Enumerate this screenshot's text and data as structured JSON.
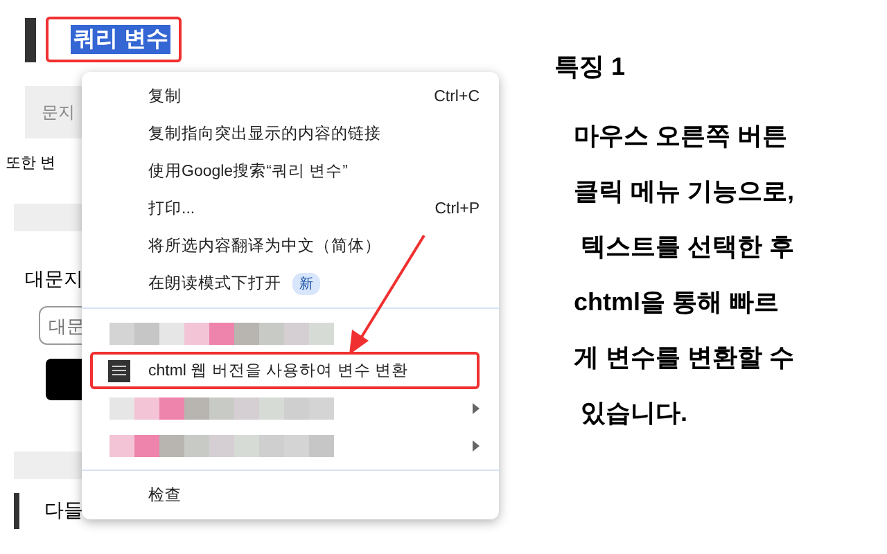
{
  "page": {
    "heading": "쿼리 변수",
    "heading_selected": true,
    "field_1": "문지",
    "text_1": "또한 변",
    "label_1": "대문지",
    "input_1": {
      "placeholder": "대문"
    },
    "heading_2": "다들"
  },
  "context_menu": {
    "items": [
      {
        "kind": "item",
        "label": "复制",
        "shortcut": "Ctrl+C"
      },
      {
        "kind": "item",
        "label": "复制指向突出显示的内容的链接"
      },
      {
        "kind": "item",
        "label": "使用Google搜索“쿼리 변수”"
      },
      {
        "kind": "item",
        "label": "打印...",
        "shortcut": "Ctrl+P"
      },
      {
        "kind": "item",
        "label": "将所选内容翻译为中文（简体）"
      },
      {
        "kind": "item",
        "label": "在朗读模式下打开",
        "badge": "新"
      },
      {
        "kind": "divider"
      },
      {
        "kind": "blurred",
        "submenu": false
      },
      {
        "kind": "item",
        "label": "chtml 웹 버전을 사용하여 변수 변환",
        "icon": true,
        "highlighted": true
      },
      {
        "kind": "blurred",
        "submenu": true
      },
      {
        "kind": "blurred",
        "submenu": true
      },
      {
        "kind": "divider"
      },
      {
        "kind": "item",
        "label": "检查"
      }
    ]
  },
  "feature": {
    "title": "특징 1",
    "lines": [
      "마우스 오른쪽 버튼",
      "클릭 메뉴 기능으로,",
      " 텍스트를 선택한 후",
      "chtml을 통해 빠르",
      "게 변수를 변환할 수",
      " 있습니다."
    ]
  }
}
